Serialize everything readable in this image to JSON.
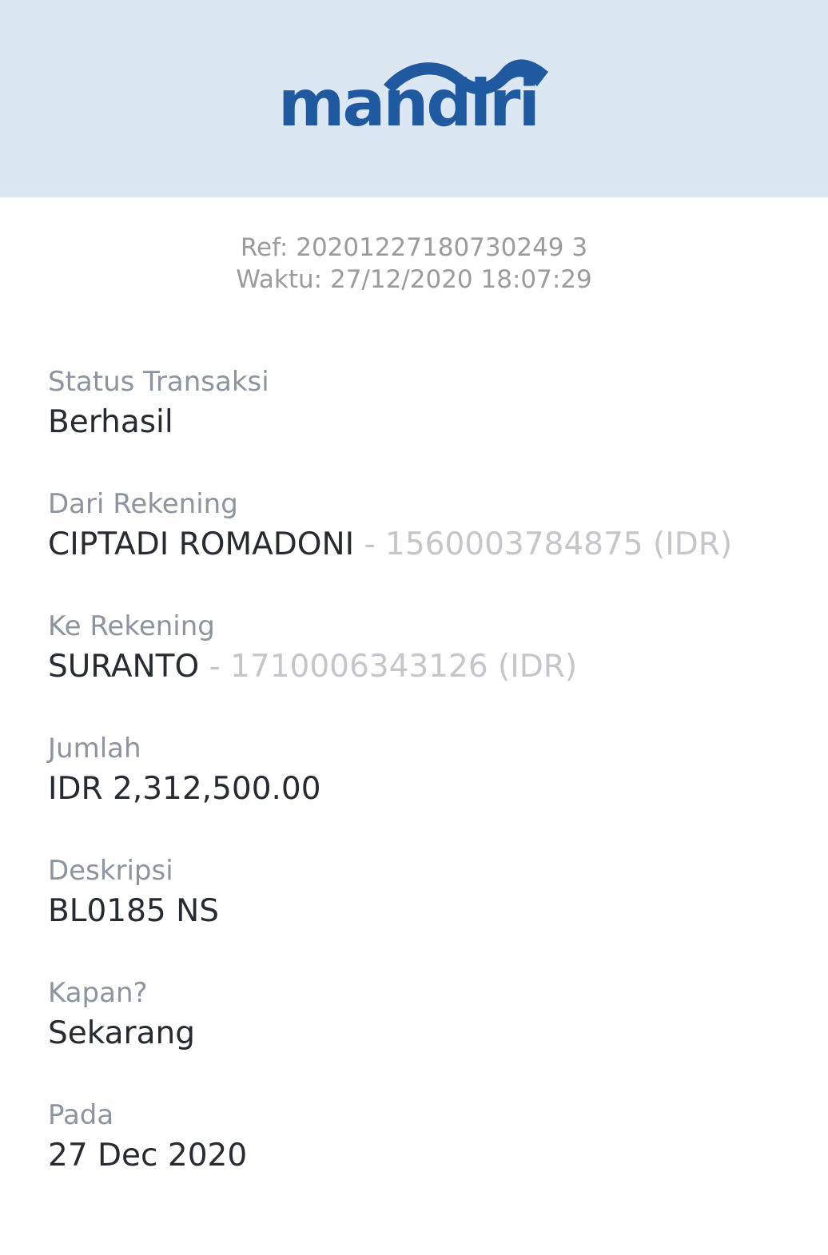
{
  "header": {
    "logo_text": "mandiri",
    "background_color": "#dbe8f4",
    "brand_color": "#1f5aa0"
  },
  "reference": {
    "ref": "Ref: 20201227180730249 3",
    "time": "Waktu: 27/12/2020 18:07:29"
  },
  "fields": {
    "status": {
      "label": "Status Transaksi",
      "value": "Berhasil"
    },
    "from": {
      "label": "Dari Rekening",
      "name": "CIPTADI ROMADONI",
      "account": " - 1560003784875 (IDR)"
    },
    "to": {
      "label": "Ke Rekening",
      "name": "SURANTO",
      "account": " - 1710006343126 (IDR)"
    },
    "amount": {
      "label": "Jumlah",
      "value": "IDR 2,312,500.00"
    },
    "description": {
      "label": "Deskripsi",
      "value": "BL0185 NS"
    },
    "when": {
      "label": "Kapan?",
      "value": "Sekarang"
    },
    "on": {
      "label": "Pada",
      "value": "27 Dec 2020"
    }
  }
}
